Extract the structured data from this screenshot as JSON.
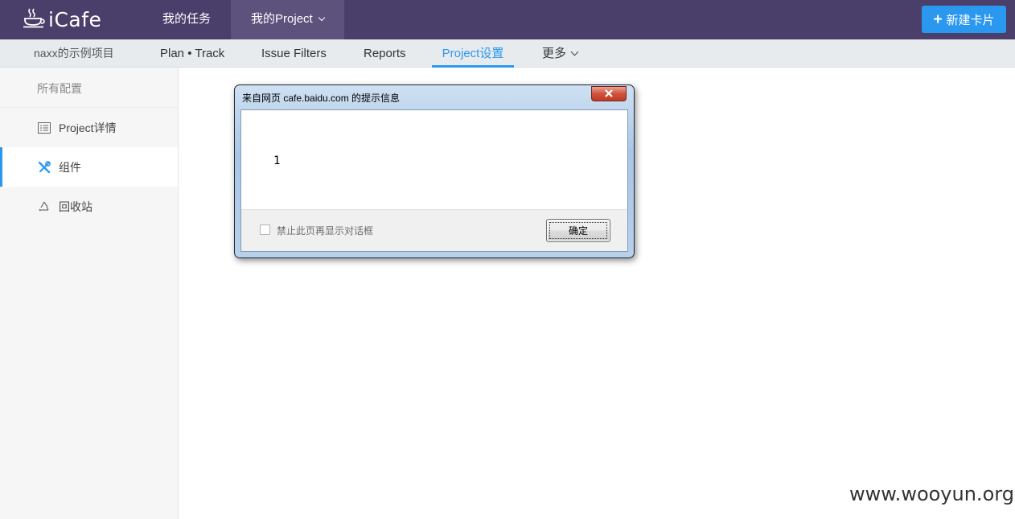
{
  "app": {
    "name": "iCafe"
  },
  "topnav": {
    "items": [
      {
        "label": "我的任务"
      },
      {
        "label": "我的Project"
      }
    ]
  },
  "new_card_button": {
    "label": "新建卡片"
  },
  "subnav": {
    "project_name": "naxx的示例项目",
    "items": [
      {
        "label": "Plan • Track"
      },
      {
        "label": "Issue Filters"
      },
      {
        "label": "Reports"
      },
      {
        "label": "Project设置"
      },
      {
        "label": "更多"
      }
    ],
    "active": "Project设置"
  },
  "sidebar": {
    "title": "所有配置",
    "items": [
      {
        "label": "Project详情",
        "icon": "list-icon"
      },
      {
        "label": "组件",
        "icon": "tools-icon"
      },
      {
        "label": "回收站",
        "icon": "recycle-icon"
      }
    ],
    "active": "组件"
  },
  "dialog": {
    "title": "来自网页 cafe.baidu.com 的提示信息",
    "message": "1",
    "checkbox_label": "禁止此页再显示对话框",
    "checkbox_checked": false,
    "ok_label": "确定"
  },
  "watermark": "www.wooyun.org",
  "colors": {
    "topbar": "#4a3f6b",
    "accent": "#2b98f0"
  }
}
